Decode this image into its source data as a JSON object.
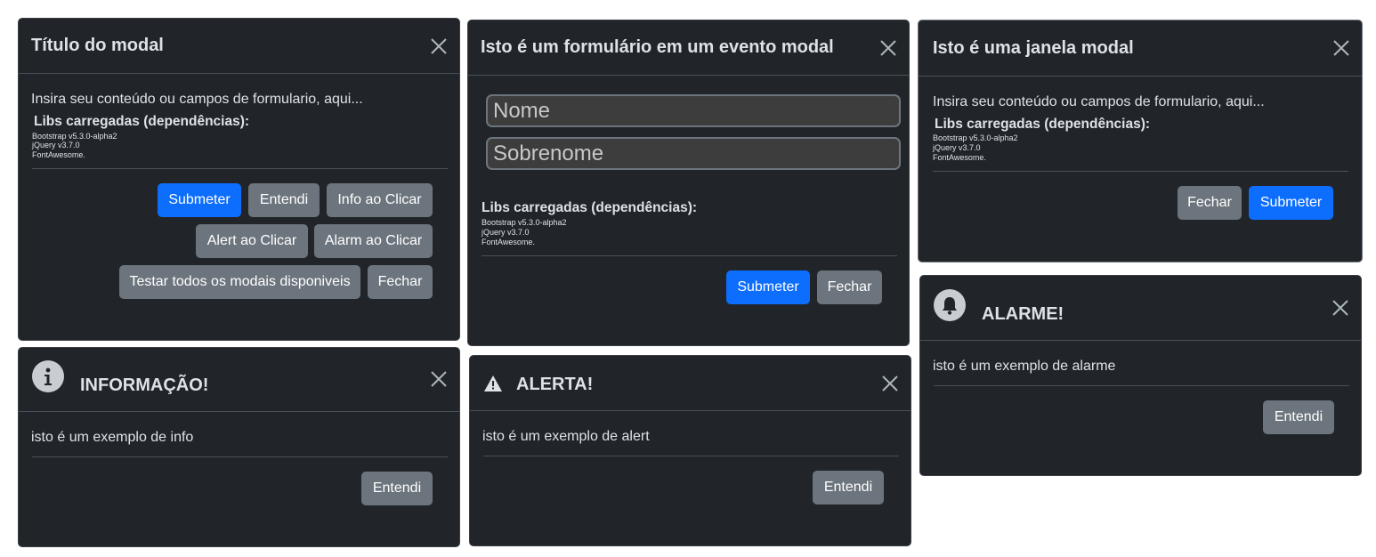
{
  "modal1": {
    "title": "Título do modal",
    "body": "Insira seu conteúdo ou campos de formulario, aqui...",
    "libs_title": "Libs carregadas (dependências):",
    "libs": [
      "Bootstrap v5.3.0-alpha2",
      "jQuery v3.7.0",
      "FontAwesome."
    ],
    "buttons": {
      "submit": "Submeter",
      "understood": "Entendi",
      "info": "Info ao Clicar",
      "alert": "Alert ao Clicar",
      "alarm": "Alarm ao Clicar",
      "test_all": "Testar todos os modais disponiveis",
      "close": "Fechar"
    }
  },
  "modal2": {
    "title": "Isto é um formulário em um evento modal",
    "first_name_placeholder": "Nome",
    "last_name_placeholder": "Sobrenome",
    "libs_title": "Libs carregadas (dependências):",
    "libs": [
      "Bootstrap v5.3.0-alpha2",
      "jQuery v3.7.0",
      "FontAwesome."
    ],
    "buttons": {
      "submit": "Submeter",
      "close": "Fechar"
    }
  },
  "modal3": {
    "title": "Isto é uma janela modal",
    "body": "Insira seu conteúdo ou campos de formulario, aqui...",
    "libs_title": "Libs carregadas (dependências):",
    "libs": [
      "Bootstrap v5.3.0-alpha2",
      "jQuery v3.7.0",
      "FontAwesome."
    ],
    "buttons": {
      "close": "Fechar",
      "submit": "Submeter"
    }
  },
  "info_modal": {
    "title": "INFORMAÇÃO!",
    "icon": "info-icon",
    "body": "isto é um exemplo de info",
    "button": "Entendi"
  },
  "alert_modal": {
    "title": "ALERTA!",
    "icon": "warning-icon",
    "body": "isto é um exemplo de alert",
    "button": "Entendi"
  },
  "alarm_modal": {
    "title": "ALARME!",
    "icon": "bell-icon",
    "body": "isto é um exemplo de alarme",
    "button": "Entendi"
  },
  "colors": {
    "modal_bg": "#212529",
    "primary": "#0d6efd",
    "secondary": "#6c757d",
    "text": "#dee2e6"
  }
}
